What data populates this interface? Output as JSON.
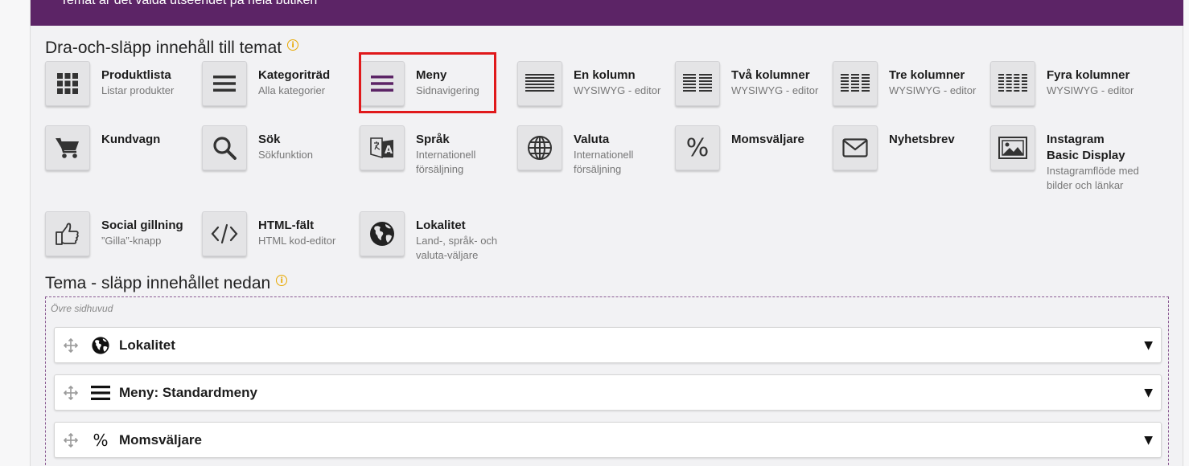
{
  "banner": {
    "text": "Temat är det valda utseendet på hela butiken"
  },
  "palette": {
    "title": "Dra-och-släpp innehåll till temat",
    "items": [
      {
        "title": "Produktlista",
        "desc": "Listar produkter",
        "icon": "grid-icon"
      },
      {
        "title": "Kategoriträd",
        "desc": "Alla kategorier",
        "icon": "hamburger-icon"
      },
      {
        "title": "Meny",
        "desc": "Sidnavigering",
        "icon": "menu-icon"
      },
      {
        "title": "En kolumn",
        "desc": "WYSIWYG - editor",
        "icon": "one-column-icon"
      },
      {
        "title": "Två kolumner",
        "desc": "WYSIWYG - editor",
        "icon": "two-columns-icon"
      },
      {
        "title": "Tre kolumner",
        "desc": "WYSIWYG - editor",
        "icon": "three-columns-icon"
      },
      {
        "title": "Fyra kolumner",
        "desc": "WYSIWYG - editor",
        "icon": "four-columns-icon"
      },
      {
        "title": "Kundvagn",
        "desc": "",
        "icon": "cart-icon"
      },
      {
        "title": "Sök",
        "desc": "Sökfunktion",
        "icon": "search-icon"
      },
      {
        "title": "Språk",
        "desc": "Internationell försäljning",
        "icon": "translate-icon"
      },
      {
        "title": "Valuta",
        "desc": "Internationell försäljning",
        "icon": "globe-icon"
      },
      {
        "title": "Momsväljare",
        "desc": "",
        "icon": "percent-icon"
      },
      {
        "title": "Nyhetsbrev",
        "desc": "",
        "icon": "envelope-icon"
      },
      {
        "title": "Instagram Basic Display",
        "desc": "Instagramflöde med bilder och länkar",
        "icon": "image-icon"
      },
      {
        "title": "Social gillning",
        "desc": "”Gilla”-knapp",
        "icon": "thumbs-up-icon"
      },
      {
        "title": "HTML-fält",
        "desc": "HTML kod-editor",
        "icon": "code-icon"
      },
      {
        "title": "Lokalitet",
        "desc": "Land-, språk- och valuta-väljare",
        "icon": "earth-icon"
      }
    ]
  },
  "theme": {
    "title": "Tema - släpp innehållet nedan",
    "zone_label": "Övre sidhuvud",
    "rows": [
      {
        "title": "Lokalitet",
        "icon": "earth-icon"
      },
      {
        "title": "Meny: Standardmeny",
        "icon": "hamburger-icon"
      },
      {
        "title": "Momsväljare",
        "icon": "percent-icon"
      }
    ],
    "caret": "▼"
  },
  "colors": {
    "brand": "#5c2466",
    "highlight": "#e0191b",
    "info": "#e8a800"
  }
}
